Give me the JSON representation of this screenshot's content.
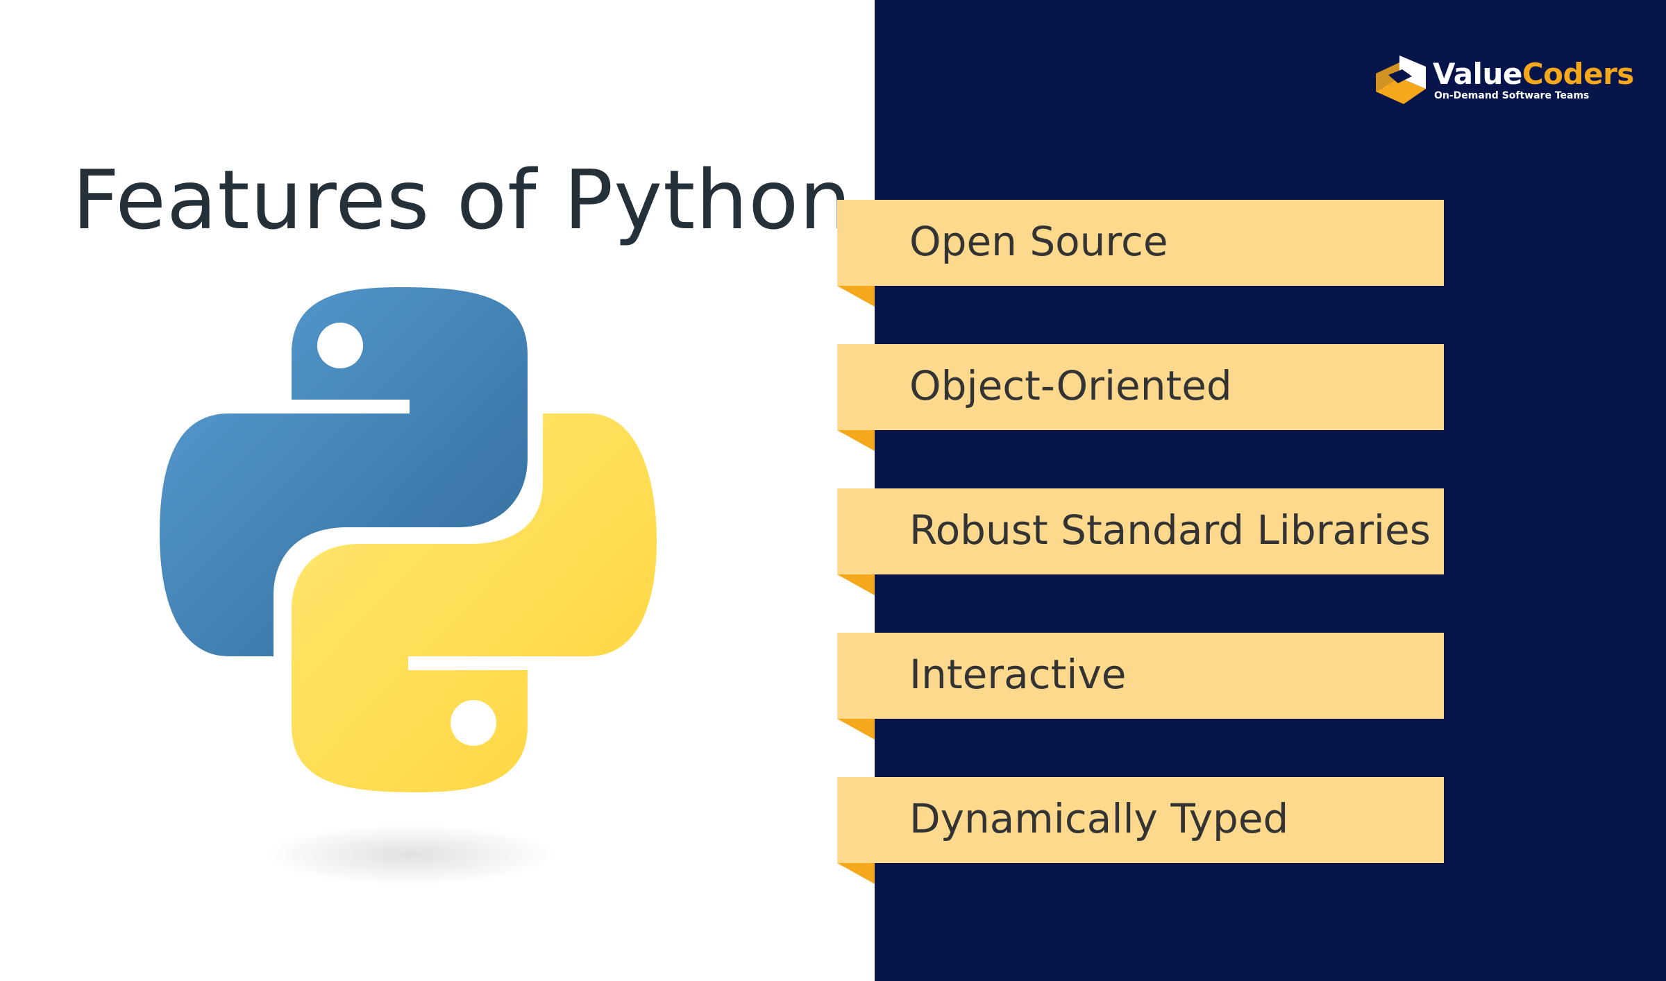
{
  "title": "Features of Python",
  "brand": {
    "name_part1": "Value",
    "name_part2": "Coders",
    "tagline": "On-Demand Software Teams",
    "icon": "valuecoders-cube-logo",
    "colors": {
      "navy": "#08154a",
      "orange": "#f6a81c",
      "white": "#ffffff"
    }
  },
  "logo": {
    "icon": "python-logo",
    "colors": {
      "blue": "#3a75a9",
      "yellow": "#ffd845"
    }
  },
  "features": [
    {
      "label": "Open Source"
    },
    {
      "label": "Object-Oriented"
    },
    {
      "label": "Robust Standard Libraries"
    },
    {
      "label": "Interactive"
    },
    {
      "label": "Dynamically Typed"
    }
  ],
  "colors": {
    "background": "#ffffff",
    "panel": "#08154a",
    "ribbon": "#fdd98e",
    "ribbon_fold": "#f6a81c",
    "title_text": "#263038",
    "item_text": "#333333"
  }
}
